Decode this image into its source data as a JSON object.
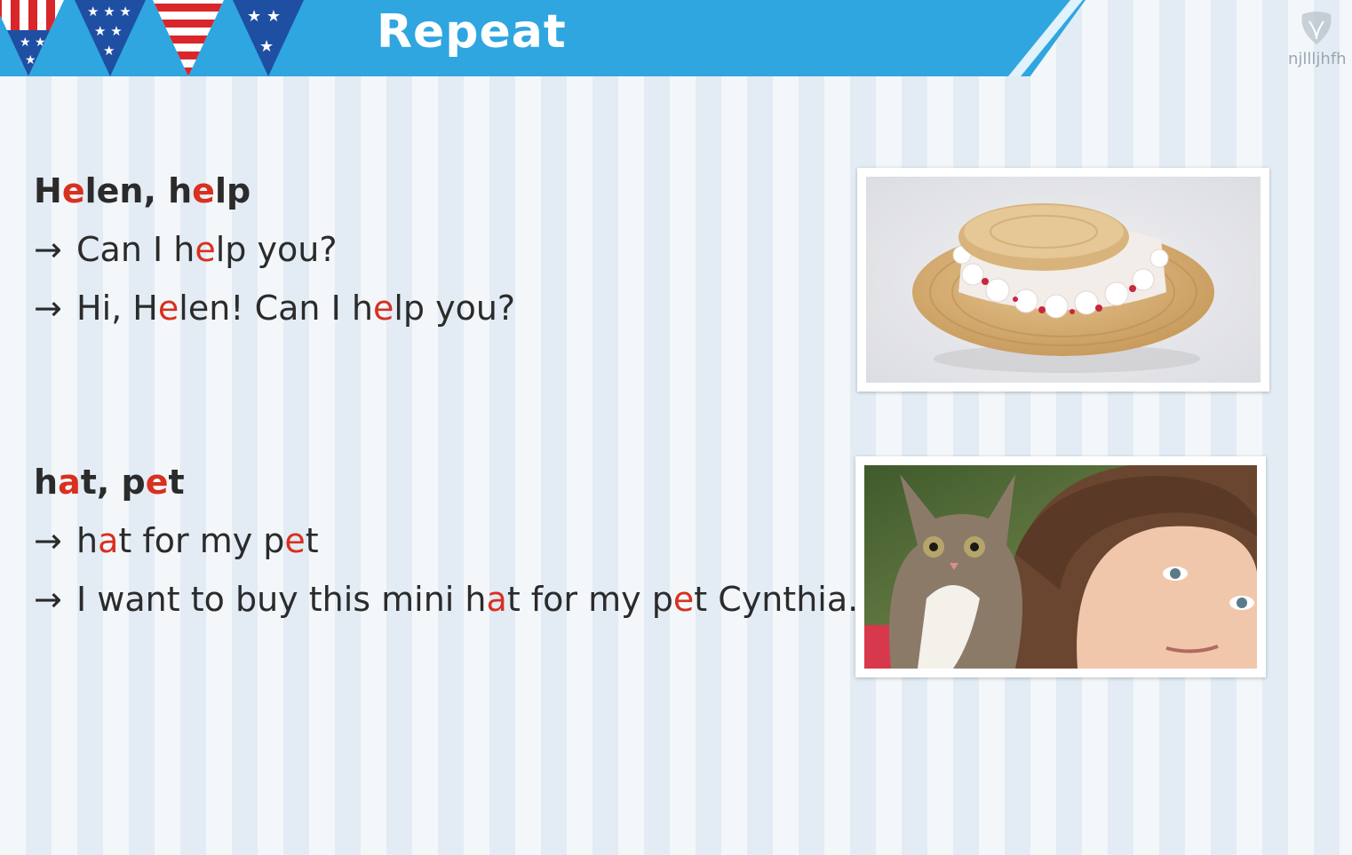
{
  "header": {
    "title": "Repeat"
  },
  "watermark": {
    "text": "njllljhfh"
  },
  "section1": {
    "heading": {
      "p1": "H",
      "r1": "e",
      "p2": "len, h",
      "r2": "e",
      "p3": "lp"
    },
    "line1": {
      "arrow": "→",
      "p1": "Can I h",
      "r1": "e",
      "p2": "lp you?"
    },
    "line2": {
      "arrow": "→",
      "p1": "Hi, H",
      "r1": "e",
      "p2": "len! Can I h",
      "r2": "e",
      "p3": "lp you?"
    }
  },
  "section2": {
    "heading": {
      "p1": "h",
      "r1": "a",
      "p2": "t, p",
      "r2": "e",
      "p3": "t"
    },
    "line1": {
      "arrow": "→",
      "p1": "h",
      "r1": "a",
      "p2": "t for my p",
      "r2": "e",
      "p3": "t"
    },
    "line2": {
      "arrow": "→",
      "p1": "I want to buy this mini h",
      "r1": "a",
      "p2": "t for my p",
      "r2": "e",
      "p3": "t Cynthia."
    }
  },
  "colors": {
    "banner": "#2fa6e0",
    "highlight": "#d9301f",
    "text": "#2b2b2b"
  },
  "images": {
    "photo1": "straw-hat-with-flowers",
    "photo2": "girl-with-kitten"
  }
}
